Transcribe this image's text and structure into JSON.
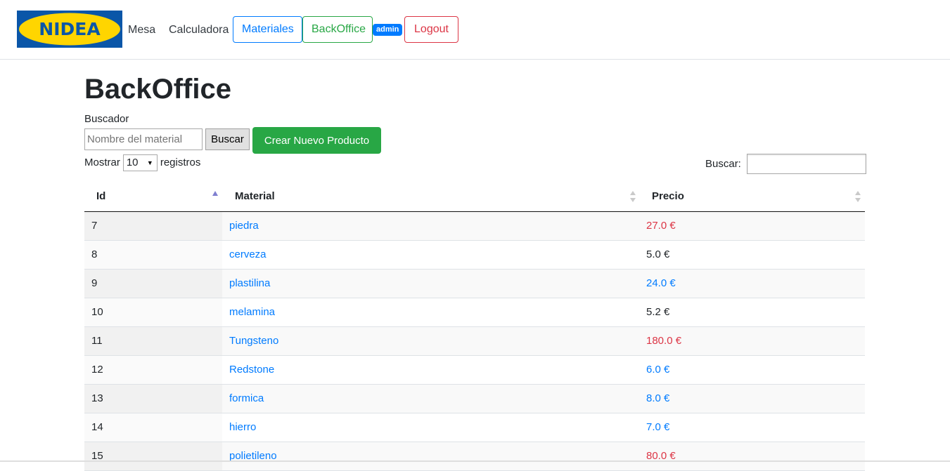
{
  "navbar": {
    "logo_text": "NIDEA",
    "links": [
      {
        "label": "Mesa"
      },
      {
        "label": "Calculadora"
      }
    ],
    "materiales_label": "Materiales",
    "backoffice_label": "BackOffice",
    "role_badge": "admin",
    "logout_label": "Logout"
  },
  "main": {
    "title": "BackOffice",
    "search_label": "Buscador",
    "search_placeholder": "Nombre del material",
    "search_button": "Buscar",
    "create_button": "Crear Nuevo Producto",
    "length_prefix": "Mostrar",
    "length_value": "10",
    "length_suffix": "registros",
    "filter_label": "Buscar:"
  },
  "colors": {
    "primary": "#007bff",
    "success": "#28a745",
    "danger": "#dc3545",
    "text": "#212529"
  },
  "table": {
    "columns": [
      "Id",
      "Material",
      "Precio"
    ],
    "sort_column": "Id",
    "sort_direction": "asc",
    "rows": [
      {
        "id": "7",
        "material": "piedra",
        "precio": "27.0 €",
        "price_color": "#dc3545"
      },
      {
        "id": "8",
        "material": "cerveza",
        "precio": "5.0 €",
        "price_color": "#212529"
      },
      {
        "id": "9",
        "material": "plastilina",
        "precio": "24.0 €",
        "price_color": "#007bff"
      },
      {
        "id": "10",
        "material": "melamina",
        "precio": "5.2 €",
        "price_color": "#212529"
      },
      {
        "id": "11",
        "material": "Tungsteno",
        "precio": "180.0 €",
        "price_color": "#dc3545"
      },
      {
        "id": "12",
        "material": "Redstone",
        "precio": "6.0 €",
        "price_color": "#007bff"
      },
      {
        "id": "13",
        "material": "formica",
        "precio": "8.0 €",
        "price_color": "#007bff"
      },
      {
        "id": "14",
        "material": "hierro",
        "precio": "7.0 €",
        "price_color": "#007bff"
      },
      {
        "id": "15",
        "material": "polietileno",
        "precio": "80.0 €",
        "price_color": "#dc3545"
      }
    ]
  }
}
